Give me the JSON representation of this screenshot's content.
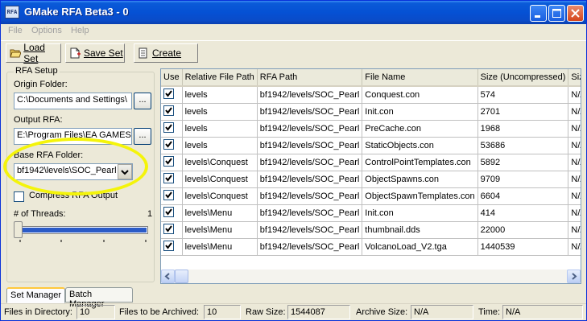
{
  "window": {
    "title": "GMake RFA Beta3 - 0",
    "icon_text": "RFA"
  },
  "menu": {
    "items": [
      "File",
      "Options",
      "Help"
    ]
  },
  "toolbar": {
    "load_label": "Load Set",
    "save_label": "Save Set",
    "create_label": "Create"
  },
  "setup": {
    "group_title": "RFA Setup",
    "origin_label": "Origin Folder:",
    "origin_value": "C:\\Documents and Settings\\",
    "output_label": "Output RFA:",
    "output_value": "E:\\Program Files\\EA GAMES\\",
    "base_label": "Base RFA Folder:",
    "base_value": "bf1942\\levels\\SOC_Pearl",
    "compress_label": "Compress RFA Output",
    "threads_label": "# of Threads:",
    "threads_value": "1",
    "browse_label": "..."
  },
  "grid": {
    "columns": [
      "Use",
      "Relative File Path",
      "RFA Path",
      "File Name",
      "Size (Uncompressed)",
      "Size (Compressed)"
    ],
    "rows": [
      {
        "use": true,
        "rel": "levels",
        "rfa": "bf1942/levels/SOC_Pearl",
        "name": "Conquest.con",
        "size": "574",
        "csize": "N/A"
      },
      {
        "use": true,
        "rel": "levels",
        "rfa": "bf1942/levels/SOC_Pearl",
        "name": "Init.con",
        "size": "2701",
        "csize": "N/A"
      },
      {
        "use": true,
        "rel": "levels",
        "rfa": "bf1942/levels/SOC_Pearl",
        "name": "PreCache.con",
        "size": "1968",
        "csize": "N/A"
      },
      {
        "use": true,
        "rel": "levels",
        "rfa": "bf1942/levels/SOC_Pearl",
        "name": "StaticObjects.con",
        "size": "53686",
        "csize": "N/A"
      },
      {
        "use": true,
        "rel": "levels\\Conquest",
        "rfa": "bf1942/levels/SOC_Pearl",
        "name": "ControlPointTemplates.con",
        "size": "5892",
        "csize": "N/A"
      },
      {
        "use": true,
        "rel": "levels\\Conquest",
        "rfa": "bf1942/levels/SOC_Pearl",
        "name": "ObjectSpawns.con",
        "size": "9709",
        "csize": "N/A"
      },
      {
        "use": true,
        "rel": "levels\\Conquest",
        "rfa": "bf1942/levels/SOC_Pearl",
        "name": "ObjectSpawnTemplates.con",
        "size": "6604",
        "csize": "N/A"
      },
      {
        "use": true,
        "rel": "levels\\Menu",
        "rfa": "bf1942/levels/SOC_Pearl",
        "name": "Init.con",
        "size": "414",
        "csize": "N/A"
      },
      {
        "use": true,
        "rel": "levels\\Menu",
        "rfa": "bf1942/levels/SOC_Pearl",
        "name": "thumbnail.dds",
        "size": "22000",
        "csize": "N/A"
      },
      {
        "use": true,
        "rel": "levels\\Menu",
        "rfa": "bf1942/levels/SOC_Pearl",
        "name": "VolcanoLoad_V2.tga",
        "size": "1440539",
        "csize": "N/A"
      }
    ]
  },
  "tabs": {
    "set_manager": "Set Manager",
    "batch_manager": "Batch Manager"
  },
  "status": {
    "files_in_dir_label": "Files in Directory:",
    "files_in_dir_value": "10",
    "to_archive_label": "Files to be Archived:",
    "to_archive_value": "10",
    "raw_size_label": "Raw Size:",
    "raw_size_value": "1544087",
    "archive_size_label": "Archive Size:",
    "archive_size_value": "N/A",
    "time_label": "Time:",
    "time_value": "N/A"
  },
  "colors": {
    "titlebar": "#0551d4",
    "selection": "#316ac5",
    "highlight_annotation": "#f4f40a"
  }
}
